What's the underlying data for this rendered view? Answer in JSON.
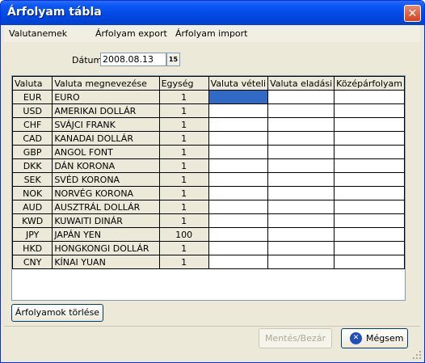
{
  "window": {
    "title": "Árfolyam tábla",
    "close_symbol": "✕"
  },
  "menu": [
    {
      "label": "Valutanemek"
    },
    {
      "label": "Árfolyam export"
    },
    {
      "label": "Árfolyam import"
    }
  ],
  "date": {
    "label": "Dátum:",
    "value": "2008.08.13",
    "calendar_icon_text": "15"
  },
  "table": {
    "headers": [
      "Valuta",
      "Valuta megnevezése",
      "Egység",
      "Valuta vételi",
      "Valuta eladási",
      "Középárfolyam"
    ],
    "rows": [
      {
        "code": "EUR",
        "name": "EURO",
        "unit": "1"
      },
      {
        "code": "USD",
        "name": "AMERIKAI DOLLÁR",
        "unit": "1"
      },
      {
        "code": "CHF",
        "name": "SVÁJCI FRANK",
        "unit": "1"
      },
      {
        "code": "CAD",
        "name": "KANADAI DOLLÁR",
        "unit": "1"
      },
      {
        "code": "GBP",
        "name": "ANGOL FONT",
        "unit": "1"
      },
      {
        "code": "DKK",
        "name": "DÁN KORONA",
        "unit": "1"
      },
      {
        "code": "SEK",
        "name": "SVÉD KORONA",
        "unit": "1"
      },
      {
        "code": "NOK",
        "name": "NORVÉG KORONA",
        "unit": "1"
      },
      {
        "code": "AUD",
        "name": "AUSZTRÁL DOLLÁR",
        "unit": "1"
      },
      {
        "code": "KWD",
        "name": "KUWAITI DINÁR",
        "unit": "1"
      },
      {
        "code": "JPY",
        "name": "JAPÁN YEN",
        "unit": "100"
      },
      {
        "code": "HKD",
        "name": "HONGKONGI DOLLÁR",
        "unit": "1"
      },
      {
        "code": "CNY",
        "name": "KÍNAI YUAN",
        "unit": "1"
      }
    ]
  },
  "buttons": {
    "clear": "Árfolyamok törlése",
    "save": "Mentés/Bezár",
    "cancel": "Mégsem"
  },
  "colors": {
    "selection": "#316ac5",
    "title_bar": "#0148e0"
  }
}
